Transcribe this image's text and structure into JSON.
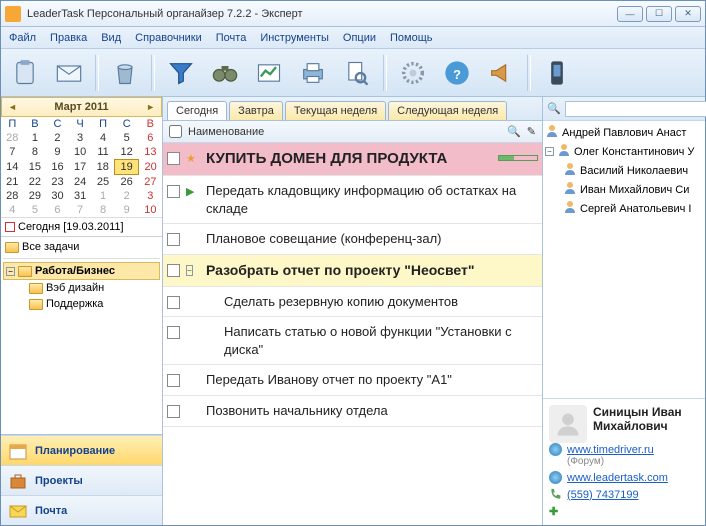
{
  "window": {
    "title": "LeaderTask Персональный органайзер 7.2.2 - Эксперт"
  },
  "menu": {
    "file": "Файл",
    "edit": "Правка",
    "view": "Вид",
    "ref": "Справочники",
    "mail": "Почта",
    "tools": "Инструменты",
    "options": "Опции",
    "help": "Помощь"
  },
  "calendar": {
    "title": "Март 2011",
    "dow": [
      "П",
      "В",
      "С",
      "Ч",
      "П",
      "С",
      "В"
    ],
    "weeks": [
      [
        "28",
        "1",
        "2",
        "3",
        "4",
        "5",
        "6"
      ],
      [
        "7",
        "8",
        "9",
        "10",
        "11",
        "12",
        "13"
      ],
      [
        "14",
        "15",
        "16",
        "17",
        "18",
        "19",
        "20"
      ],
      [
        "21",
        "22",
        "23",
        "24",
        "25",
        "26",
        "27"
      ],
      [
        "28",
        "29",
        "30",
        "31",
        "1",
        "2",
        "3"
      ],
      [
        "4",
        "5",
        "6",
        "7",
        "8",
        "9",
        "10"
      ]
    ],
    "today_label": "Сегодня [19.03.2011]"
  },
  "tree": {
    "all": "Все задачи",
    "work": "Работа/Бизнес",
    "web": "Вэб дизайн",
    "support": "Поддержка"
  },
  "nav": {
    "plan": "Планирование",
    "proj": "Проекты",
    "mail": "Почта"
  },
  "tabs": {
    "today": "Сегодня",
    "tomorrow": "Завтра",
    "week": "Текущая неделя",
    "next": "Следующая неделя"
  },
  "list": {
    "header": "Наименование"
  },
  "tasks": [
    {
      "text": "КУПИТЬ ДОМЕН ДЛЯ ПРОДУКТА",
      "style": "pink",
      "progress": 40,
      "star": true
    },
    {
      "text": "Передать кладовщику информацию об остатках на складе",
      "play": true
    },
    {
      "text": "Плановое совещание (конференц-зал)"
    },
    {
      "text": "Разобрать отчет по проекту \"Неосвет\"",
      "style": "yellow",
      "expand": true
    },
    {
      "text": "Сделать резервную копию документов",
      "indent": true
    },
    {
      "text": "Написать статью о новой функции \"Установки с диска\"",
      "indent": true
    },
    {
      "text": "Передать Иванову отчет по проекту \"А1\""
    },
    {
      "text": "Позвонить начальнику отдела"
    }
  ],
  "contacts": {
    "items": [
      "Андрей Павлович Анаст",
      "Олег Константинович У",
      "Василий Николаевич",
      "Иван Михайлович Си",
      "Сергей Анатольевич I"
    ]
  },
  "card": {
    "name": "Синицын Иван Михайлович",
    "link1": "www.timedriver.ru",
    "link1_sub": "(Форум)",
    "link2": "www.leadertask.com",
    "phone": "(559) 7437199"
  }
}
